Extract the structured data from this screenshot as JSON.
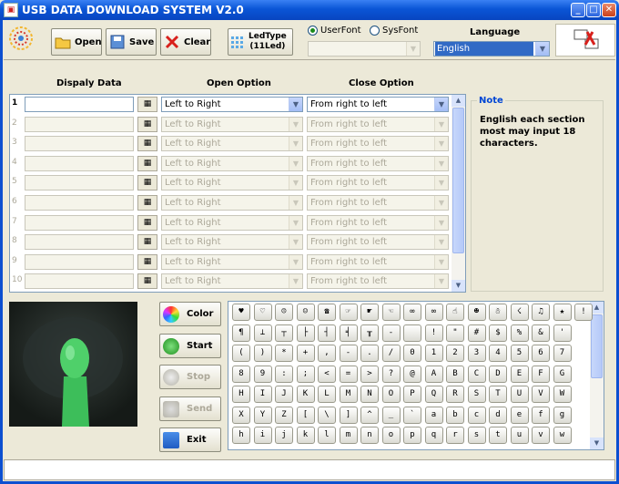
{
  "window": {
    "title": "USB DATA DOWNLOAD SYSTEM V2.0"
  },
  "toolbar": {
    "open": "Open",
    "save": "Save",
    "clear": "Clear",
    "ledtype_line1": "LedType",
    "ledtype_line2": "(11Led)"
  },
  "font": {
    "userfont": "UserFont",
    "sysfont": "SysFont",
    "selected": "UserFont"
  },
  "language": {
    "label": "Language",
    "value": "English"
  },
  "columns": {
    "display": "Dispaly Data",
    "open": "Open Option",
    "close": "Close Option"
  },
  "rows": [
    {
      "num": "1",
      "open": "Left to Right",
      "close": "From right to left",
      "enabled": true
    },
    {
      "num": "2",
      "open": "Left to Right",
      "close": "From right to left",
      "enabled": false
    },
    {
      "num": "3",
      "open": "Left to Right",
      "close": "From right to left",
      "enabled": false
    },
    {
      "num": "4",
      "open": "Left to Right",
      "close": "From right to left",
      "enabled": false
    },
    {
      "num": "5",
      "open": "Left to Right",
      "close": "From right to left",
      "enabled": false
    },
    {
      "num": "6",
      "open": "Left to Right",
      "close": "From right to left",
      "enabled": false
    },
    {
      "num": "7",
      "open": "Left to Right",
      "close": "From right to left",
      "enabled": false
    },
    {
      "num": "8",
      "open": "Left to Right",
      "close": "From right to left",
      "enabled": false
    },
    {
      "num": "9",
      "open": "Left to Right",
      "close": "From right to left",
      "enabled": false
    },
    {
      "num": "10",
      "open": "Left to Right",
      "close": "From right to left",
      "enabled": false
    }
  ],
  "note": {
    "title": "Note",
    "text": "English each section most may input 18 characters."
  },
  "actions": {
    "color": "Color",
    "start": "Start",
    "stop": "Stop",
    "send": "Send",
    "exit": "Exit"
  },
  "charmap": [
    [
      "♥",
      "♡",
      "☹",
      "☺",
      "☎",
      "☞",
      "☛",
      "☜",
      "∞",
      "∞",
      "☝",
      "☻",
      "☃",
      "☇",
      "♫",
      "★",
      "!"
    ],
    [
      "¶",
      "⊥",
      "┬",
      "├",
      "┤",
      "╡",
      "╥",
      "-",
      "",
      "!",
      "\"",
      "#",
      "$",
      "%",
      "&",
      "'"
    ],
    [
      "(",
      ")",
      "*",
      "+",
      ",",
      "-",
      ".",
      "/",
      "0",
      "1",
      "2",
      "3",
      "4",
      "5",
      "6",
      "7"
    ],
    [
      "8",
      "9",
      ":",
      ";",
      "<",
      "=",
      ">",
      "?",
      "@",
      "A",
      "B",
      "C",
      "D",
      "E",
      "F",
      "G"
    ],
    [
      "H",
      "I",
      "J",
      "K",
      "L",
      "M",
      "N",
      "O",
      "P",
      "Q",
      "R",
      "S",
      "T",
      "U",
      "V",
      "W"
    ],
    [
      "X",
      "Y",
      "Z",
      "[",
      "\\",
      "]",
      "^",
      "_",
      "`",
      "a",
      "b",
      "c",
      "d",
      "e",
      "f",
      "g"
    ],
    [
      "h",
      "i",
      "j",
      "k",
      "l",
      "m",
      "n",
      "o",
      "p",
      "q",
      "r",
      "s",
      "t",
      "u",
      "v",
      "w"
    ]
  ]
}
